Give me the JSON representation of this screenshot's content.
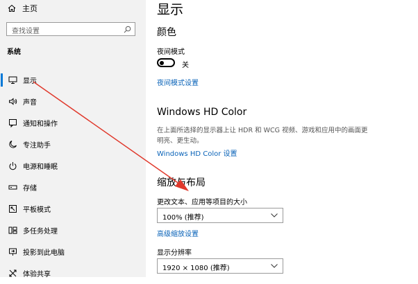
{
  "sidebar": {
    "home_label": "主页",
    "search_placeholder": "查找设置",
    "section_title": "系统",
    "items": [
      {
        "label": "显示",
        "icon": "monitor-icon"
      },
      {
        "label": "声音",
        "icon": "speaker-icon"
      },
      {
        "label": "通知和操作",
        "icon": "notification-icon"
      },
      {
        "label": "专注助手",
        "icon": "moon-icon"
      },
      {
        "label": "电源和睡眠",
        "icon": "power-icon"
      },
      {
        "label": "存储",
        "icon": "storage-icon"
      },
      {
        "label": "平板模式",
        "icon": "tablet-icon"
      },
      {
        "label": "多任务处理",
        "icon": "multitask-icon"
      },
      {
        "label": "投影到此电脑",
        "icon": "project-icon"
      },
      {
        "label": "体验共享",
        "icon": "share-icon"
      }
    ]
  },
  "main": {
    "title": "显示",
    "color": {
      "heading": "颜色",
      "night_mode_label": "夜间模式",
      "night_mode_state": "关",
      "night_mode_link": "夜间模式设置"
    },
    "hdr": {
      "heading": "Windows HD Color",
      "description": "在上面所选择的显示器上让 HDR 和 WCG 视频、游戏和应用中的画面更明亮、更生动。",
      "link": "Windows HD Color 设置"
    },
    "layout": {
      "heading": "缩放与布局",
      "scale_label": "更改文本、应用等项目的大小",
      "scale_value": "100% (推荐)",
      "advanced_link": "高级缩放设置",
      "resolution_label": "显示分辨率",
      "resolution_value": "1920 × 1080 (推荐)"
    }
  },
  "colors": {
    "accent": "#0078d7",
    "link": "#0a63b8",
    "annotation_arrow": "#e0382b",
    "sidebar_bg": "#f2f2f2"
  }
}
